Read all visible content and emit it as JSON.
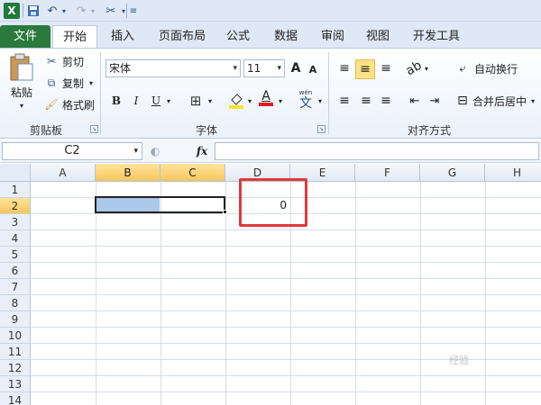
{
  "tabs": [
    "文件",
    "开始",
    "插入",
    "页面布局",
    "公式",
    "数据",
    "审阅",
    "视图",
    "开发工具"
  ],
  "ribbon": {
    "clipboard": {
      "paste": "粘贴",
      "cut": "剪切",
      "copy": "复制",
      "format_painter": "格式刷",
      "label": "剪贴板"
    },
    "font": {
      "name": "宋体",
      "size": "11",
      "grow": "A",
      "shrink": "A",
      "bold": "B",
      "italic": "I",
      "underline": "U",
      "font_color": "A",
      "label": "字体",
      "wen": "文"
    },
    "alignment": {
      "wrap": "自动换行",
      "merge": "合并后居中",
      "label": "对齐方式"
    }
  },
  "formula_bar": {
    "name_box": "C2",
    "fx": "fx",
    "value": ""
  },
  "grid": {
    "columns": [
      "A",
      "B",
      "C",
      "D",
      "E",
      "F",
      "G",
      "H"
    ],
    "rows": [
      "1",
      "2",
      "3",
      "4",
      "5",
      "6",
      "7",
      "8",
      "9",
      "10",
      "11",
      "12",
      "13",
      "14"
    ],
    "cell_d2": "0"
  },
  "watermark": "经验",
  "colors": {
    "file_tab": "#2a7a3d",
    "highlight": "#e0393a",
    "selection": "#a9c8ea",
    "header_selected": "#f6c75c"
  }
}
